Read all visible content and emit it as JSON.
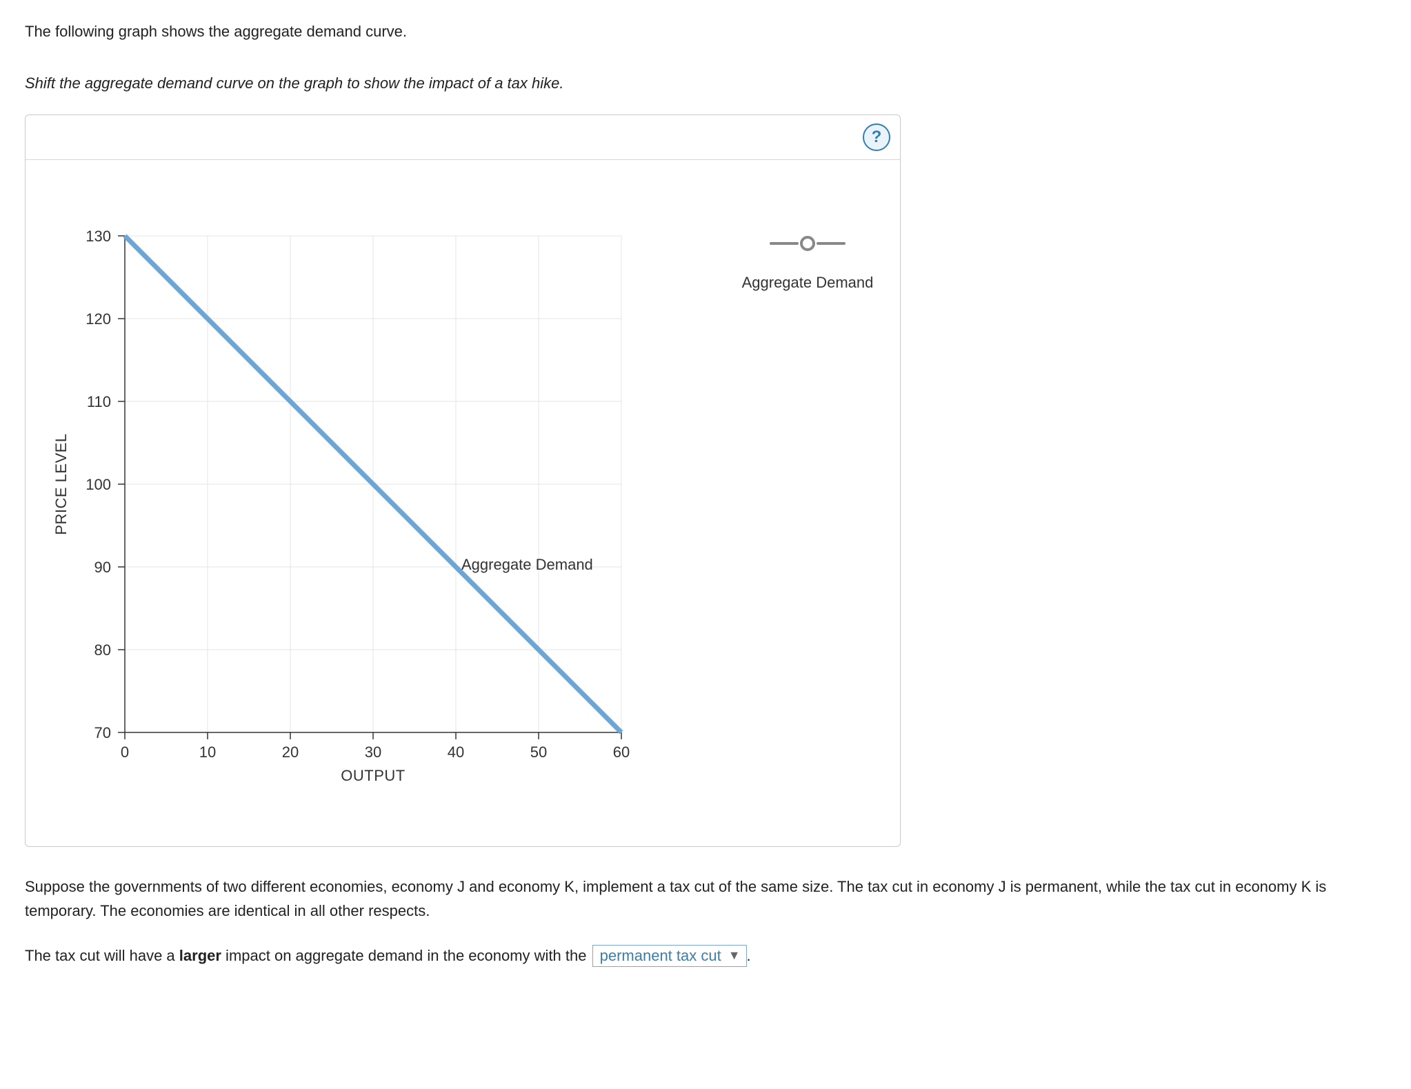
{
  "intro_text": "The following graph shows the aggregate demand curve.",
  "instruction_text": "Shift the aggregate demand curve on the graph to show the impact of a tax hike.",
  "help_symbol": "?",
  "legend": {
    "label": "Aggregate Demand"
  },
  "chart_data": {
    "type": "line",
    "title": "",
    "xlabel": "OUTPUT",
    "ylabel": "PRICE LEVEL",
    "xlim": [
      0,
      60
    ],
    "ylim": [
      70,
      130
    ],
    "x_ticks": [
      0,
      10,
      20,
      30,
      40,
      50,
      60
    ],
    "y_ticks": [
      70,
      80,
      90,
      100,
      110,
      120,
      130
    ],
    "grid": true,
    "series": [
      {
        "name": "Aggregate Demand",
        "color": "#6ba6d6",
        "x": [
          0,
          60
        ],
        "y": [
          130,
          70
        ],
        "label_at": {
          "x": 40,
          "y": 90
        }
      }
    ]
  },
  "followup": {
    "paragraph1": "Suppose the governments of two different economies, economy J and economy K, implement a tax cut of the same size. The tax cut in economy J is permanent, while the tax cut in economy K is temporary. The economies are identical in all other respects.",
    "sentence_prefix": "The tax cut will have a ",
    "sentence_bold": "larger",
    "sentence_mid": " impact on aggregate demand in the economy with the",
    "select_value": "permanent tax cut",
    "sentence_suffix": "."
  }
}
